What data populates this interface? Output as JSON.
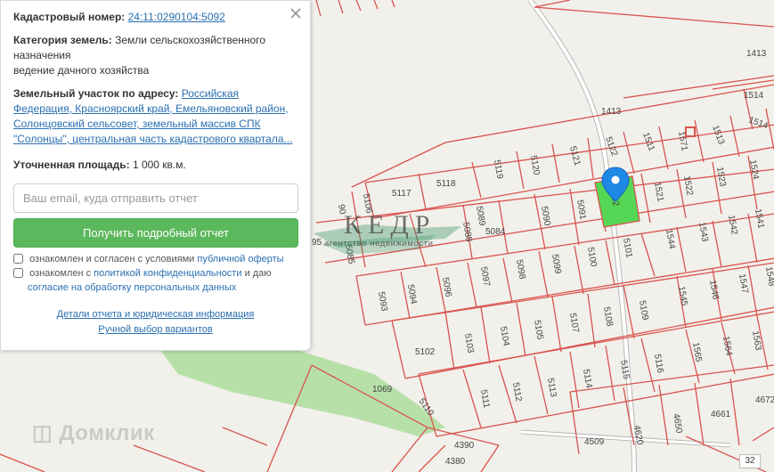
{
  "panel": {
    "cadastral_label": "Кадастровый номер:",
    "cadastral_number": "24:11:0290104:5092",
    "category_label": "Категория земель:",
    "category_line1": "Земли сельскохозяйственного",
    "category_line2": "назначения",
    "category_line3": "ведение дачного хозяйства",
    "address_label": "Земельный участок по адресу:",
    "address_part1": "Российская",
    "address_part2": "Федерация, Красноярский край, Емельяновский район,",
    "address_part3": "Солонцовский сельсовет, земельный массив СПК",
    "address_part4": "\"Солонцы\", центральная часть кадастрового квартала...",
    "area_label": "Уточненная площадь:",
    "area_value": "1 000 кв.м.",
    "email_placeholder": "Ваш email, куда отправить отчет",
    "report_button": "Получить подробный отчет",
    "agree1_text": "ознакомлен и согласен с условиями",
    "agree1_link": "публичной оферты",
    "agree2_text": "ознакомлен с",
    "agree2_link": "политикой конфиденциальности",
    "agree2_text2": "и даю",
    "agree2_link2": "согласие на обработку персональных данных",
    "details_link": "Детали отчета и юридическая информация",
    "manual_link": "Ручной выбор вариантов"
  },
  "map": {
    "selected_color": "#55d655",
    "boundary_color": "#d9534f",
    "marker_color": "#1e88e5",
    "park_color": "#b7e0a8",
    "labels": {
      "p1413a": "1413",
      "p1413b": "1413",
      "p1514": "1514",
      "p1514b": "1514",
      "p1513": "1513",
      "p1571": "1571",
      "p1511": "1511",
      "p5122": "5122",
      "p5121": "5121",
      "p5120": "5120",
      "p5119": "5119",
      "p5118": "5118",
      "p5117": "5117",
      "p5106": "5106",
      "p5089": "5089",
      "p5090": "5090",
      "p5091": "5091",
      "p5092": "5092",
      "p1521": "1521",
      "p1522": "1522",
      "p1523": "1523",
      "p1524": "1524",
      "p5088": "5088",
      "p5084": "5084",
      "p5101": "5101",
      "p5100": "5100",
      "p5099": "5099",
      "p5098": "5098",
      "p5097": "5097",
      "p5096": "5096",
      "p5094": "5094",
      "p5093": "5093",
      "p5085": "5085",
      "p1544": "1544",
      "p1543": "1543",
      "p1542": "1542",
      "p1541": "1541",
      "p1545": "1545",
      "p1546": "1546",
      "p1547": "1547",
      "p1548": "1548",
      "p5109": "5109",
      "p5108": "5108",
      "p5107": "5107",
      "p5105": "5105",
      "p5104": "5104",
      "p5103": "5103",
      "p5102": "5102",
      "p1565": "1565",
      "p1564": "1564",
      "p1563": "1563",
      "p5116": "5116",
      "p5115": "5115",
      "p5114": "5114",
      "p5113": "5113",
      "p5112": "5112",
      "p5111": "5111",
      "p5110": "5110",
      "p1069": "1069",
      "p4661": "4661",
      "p4672": "4672",
      "p4650": "4650",
      "p4620": "4620",
      "p4509": "4509",
      "p4390": "4390",
      "p4380": "4380",
      "p95": "95",
      "p90": "90"
    },
    "watermark": "Домклик",
    "logo_title": "КЕДР",
    "logo_subtitle": "агентство недвижимости",
    "scale_value": "32"
  }
}
